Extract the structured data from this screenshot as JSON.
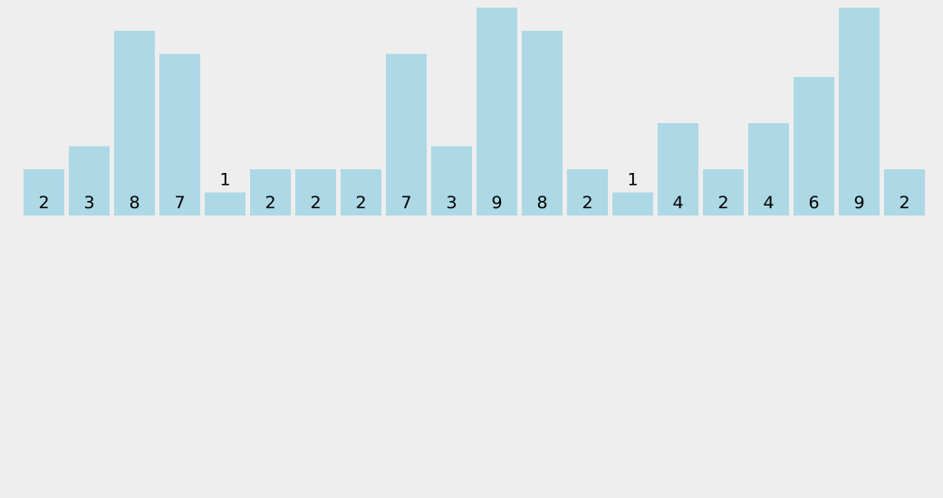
{
  "chart_data": {
    "type": "bar",
    "values": [
      2,
      3,
      8,
      7,
      1,
      2,
      2,
      2,
      7,
      3,
      9,
      8,
      2,
      1,
      4,
      2,
      4,
      6,
      9,
      2
    ],
    "ylim": [
      0,
      9
    ],
    "grid": false,
    "bar_color": "#add8e6",
    "label_color": "#000000",
    "background_color": "#eeeeee"
  }
}
